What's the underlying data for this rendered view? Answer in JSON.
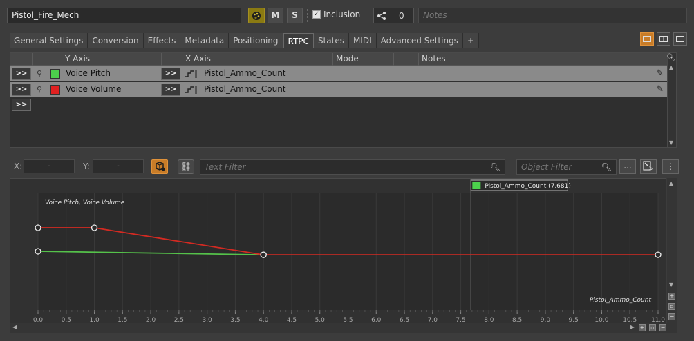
{
  "header": {
    "object_name": "Pistol_Fire_Mech",
    "m_label": "M",
    "s_label": "S",
    "inclusion_label": "Inclusion",
    "inclusion_checked": true,
    "share_count": "0",
    "notes_placeholder": "Notes"
  },
  "tabs": [
    "General Settings",
    "Conversion",
    "Effects",
    "Metadata",
    "Positioning",
    "RTPC",
    "States",
    "MIDI",
    "Advanced Settings",
    "+"
  ],
  "active_tab": "RTPC",
  "rtpc_grid": {
    "columns": {
      "y_axis": "Y Axis",
      "x_axis": "X Axis",
      "mode": "Mode",
      "notes": "Notes"
    },
    "expand_label": ">>",
    "rows": [
      {
        "y_axis": "Voice Pitch",
        "color": "#4cd04c",
        "x_axis": "Pistol_Ammo_Count"
      },
      {
        "y_axis": "Voice Volume",
        "color": "#e02020",
        "x_axis": "Pistol_Ammo_Count"
      }
    ]
  },
  "graph_toolbar": {
    "x_label": "X:",
    "y_label": "Y:",
    "x_value": "-",
    "y_value": "-",
    "text_filter_placeholder": "Text Filter",
    "object_filter_placeholder": "Object Filter",
    "more_label": "..."
  },
  "chart_data": {
    "type": "line",
    "title": "Voice Pitch, Voice Volume",
    "xlabel": "Pistol_Ammo_Count",
    "xlim": [
      0,
      11
    ],
    "x_ticks": [
      "0.0",
      "0.5",
      "1.0",
      "1.5",
      "2.0",
      "2.5",
      "3.0",
      "3.5",
      "4.0",
      "4.5",
      "5.0",
      "5.5",
      "6.0",
      "6.5",
      "7.0",
      "7.5",
      "8.0",
      "8.5",
      "9.0",
      "9.5",
      "10.0",
      "10.5",
      "11.0"
    ],
    "cursor": {
      "x": 7.681,
      "label": "Pistol_Ammo_Count (7.681)"
    },
    "series": [
      {
        "name": "Voice Pitch",
        "color": "#55c24a",
        "points": [
          [
            0,
            0.0
          ],
          [
            4,
            -0.06
          ]
        ]
      },
      {
        "name": "Voice Volume",
        "color": "#d42a22",
        "points": [
          [
            0,
            0.4
          ],
          [
            1,
            0.4
          ],
          [
            4,
            -0.06
          ],
          [
            11,
            -0.06
          ]
        ]
      }
    ],
    "ylim": [
      -1,
      1
    ]
  }
}
